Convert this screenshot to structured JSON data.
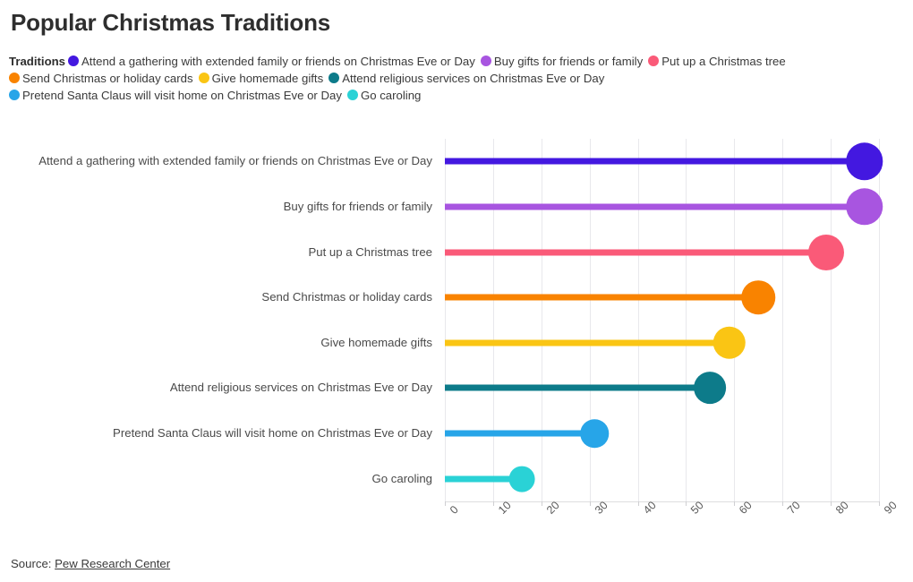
{
  "title": "Popular Christmas Traditions",
  "legend": {
    "title": "Traditions",
    "items": [
      {
        "label": "Attend a gathering with extended family or friends on Christmas Eve or Day",
        "color": "#4318e0"
      },
      {
        "label": "Buy gifts for friends or family",
        "color": "#a855e0"
      },
      {
        "label": "Put up a Christmas tree",
        "color": "#fa5a78"
      },
      {
        "label": "Send Christmas or holiday cards",
        "color": "#f98300"
      },
      {
        "label": "Give homemade gifts",
        "color": "#fac514"
      },
      {
        "label": "Attend religious services on Christmas Eve or Day",
        "color": "#0d7b8a"
      },
      {
        "label": "Pretend Santa Claus will visit home on Christmas Eve or Day",
        "color": "#27a5e8"
      },
      {
        "label": "Go caroling",
        "color": "#2ad2d6"
      }
    ]
  },
  "footer": {
    "source_prefix": "Source: ",
    "source_name": "Pew Research Center"
  },
  "chart_data": {
    "type": "bar",
    "subtype": "lollipop-horizontal",
    "title": "Popular Christmas Traditions",
    "xlabel": "",
    "ylabel": "",
    "xlim": [
      0,
      90
    ],
    "xticks": [
      0,
      10,
      20,
      30,
      40,
      50,
      60,
      70,
      80,
      90
    ],
    "xtick_labels": [
      "0",
      "10",
      "20",
      "30",
      "40",
      "50",
      "60",
      "70",
      "80",
      "90"
    ],
    "grid": true,
    "legend_position": "top",
    "legend_title": "Traditions",
    "categories": [
      "Attend a gathering with extended family or friends on Christmas Eve or Day",
      "Buy gifts for friends or family",
      "Put up a Christmas tree",
      "Send Christmas or holiday cards",
      "Give homemade gifts",
      "Attend religious services on Christmas Eve or Day",
      "Pretend Santa Claus will visit home on Christmas Eve or Day",
      "Go caroling"
    ],
    "values": [
      87,
      87,
      79,
      65,
      59,
      55,
      31,
      16
    ],
    "colors": [
      "#4318e0",
      "#a855e0",
      "#fa5a78",
      "#f98300",
      "#fac514",
      "#0d7b8a",
      "#27a5e8",
      "#2ad2d6"
    ]
  }
}
